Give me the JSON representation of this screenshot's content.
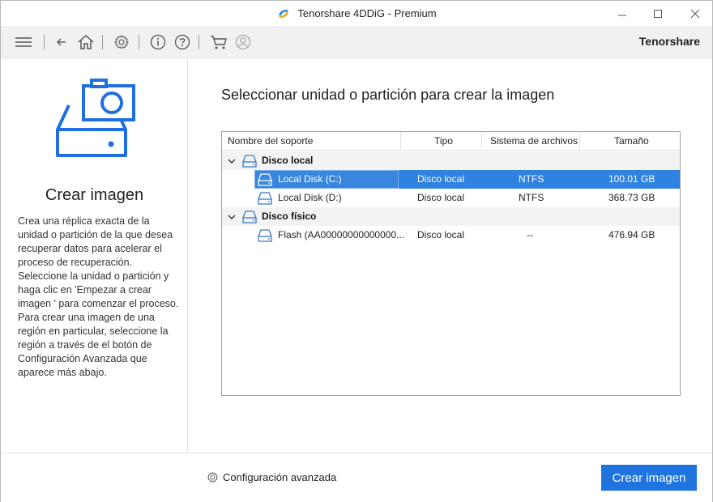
{
  "window": {
    "title": "Tenorshare 4DDiG - Premium"
  },
  "toolbar": {
    "brand": "Tenorshare",
    "icons": [
      "menu-icon",
      "back-icon",
      "home-icon",
      "settings-icon",
      "info-icon",
      "help-icon",
      "cart-icon",
      "account-icon"
    ]
  },
  "left": {
    "title": "Crear imagen",
    "description": "Crea una réplica exacta de la unidad o partición de la que desea recuperar datos para acelerar el proceso de recuperación. Seleccione la unidad o partición y haga clic en 'Empezar a crear imagen ' para comenzar el proceso. Para crear una imagen de una región en particular, seleccione la región a través de el botón de Configuración Avanzada que aparece más abajo."
  },
  "main": {
    "heading": "Seleccionar unidad o partición para crear la imagen",
    "columns": [
      "Nombre del soporte",
      "Tipo",
      "Sistema de archivos",
      "Tamaño"
    ],
    "groups": [
      {
        "label": "Disco local",
        "rows": [
          {
            "name": "Local Disk (C:)",
            "type": "Disco local",
            "fs": "NTFS",
            "size": "100.01 GB",
            "selected": true
          },
          {
            "name": "Local Disk (D:)",
            "type": "Disco local",
            "fs": "NTFS",
            "size": "368.73 GB",
            "selected": false
          }
        ]
      },
      {
        "label": "Disco físico",
        "rows": [
          {
            "name": "Flash (AA00000000000000...",
            "type": "Disco local",
            "fs": "--",
            "size": "476.94 GB",
            "selected": false
          }
        ]
      }
    ]
  },
  "footer": {
    "advanced_label": "Configuración avanzada",
    "primary_label": "Crear imagen"
  },
  "colors": {
    "accent": "#1f74e0",
    "selection": "#2f82e0"
  }
}
